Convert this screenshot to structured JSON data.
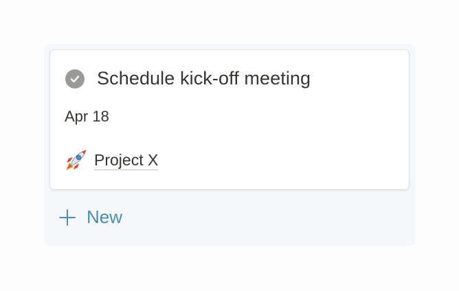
{
  "card": {
    "title": "Schedule kick-off meeting",
    "date": "Apr 18",
    "status_icon": "check-circle-icon",
    "relation": {
      "icon": "rocket-icon",
      "label": "Project X"
    }
  },
  "new_button": {
    "icon": "plus-icon",
    "label": "New"
  },
  "colors": {
    "column_bg": "#f4f8fb",
    "text": "#37352f",
    "accent": "#4a8cb3",
    "check_gray": "#9b9a97"
  }
}
